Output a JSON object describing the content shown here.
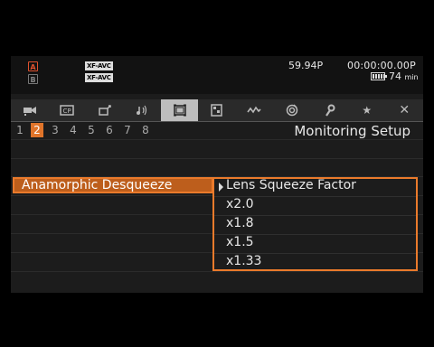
{
  "status": {
    "codec_1": "XF-AVC",
    "codec_2": "XF-AVC",
    "frame_rate": "59.94P",
    "timecode": "00:00:00.00",
    "timecode_mode": "P",
    "battery_minutes": "74",
    "battery_unit": "min"
  },
  "tabs": [
    {
      "icon": "camera-icon"
    },
    {
      "label": "CP",
      "icon": "custom-picture-icon"
    },
    {
      "icon": "camera-assist-icon"
    },
    {
      "icon": "audio-icon"
    },
    {
      "icon": "monitoring-setup-icon",
      "active": true
    },
    {
      "icon": "recording-media-icon"
    },
    {
      "icon": "system-setup-icon"
    },
    {
      "icon": "network-icon"
    },
    {
      "icon": "wrench-icon"
    },
    {
      "label": "★",
      "icon": "my-menu-icon"
    },
    {
      "label": "✕",
      "icon": "close-icon"
    }
  ],
  "pages": [
    "1",
    "2",
    "3",
    "4",
    "5",
    "6",
    "7",
    "8"
  ],
  "active_page": "2",
  "menu_title": "Monitoring Setup",
  "selected_setting": "Anamorphic Desqueeze",
  "dropdown": {
    "header": "Lens Squeeze Factor",
    "options": [
      "x2.0",
      "x1.8",
      "x1.5",
      "x1.33"
    ]
  },
  "colors": {
    "accent": "#ea7a2b",
    "selection_fill": "#bd5e1c",
    "active_tab": "#bdbdbd",
    "background": "#1c1c1c"
  }
}
